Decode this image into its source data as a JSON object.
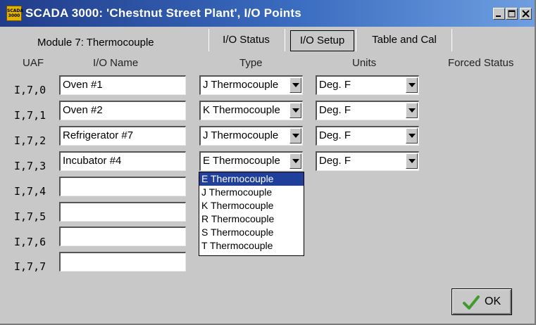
{
  "window": {
    "title": "SCADA 3000: 'Chestnut Street Plant', I/O Points",
    "app_icon_text": "SCADA 3000"
  },
  "module_label": "Module 7: Thermocouple",
  "tabs": [
    {
      "label": "I/O Status",
      "active": false
    },
    {
      "label": "I/O Setup",
      "active": true
    },
    {
      "label": "Table and Cal",
      "active": false
    }
  ],
  "headers": {
    "uaf": "UAF",
    "io_name": "I/O Name",
    "type": "Type",
    "units": "Units",
    "forced_status": "Forced Status"
  },
  "rows": [
    {
      "uaf": "I,7,0",
      "name": "Oven #1",
      "type": "J Thermocouple",
      "units": "Deg. F"
    },
    {
      "uaf": "I,7,1",
      "name": "Oven #2",
      "type": "K Thermocouple",
      "units": "Deg. F"
    },
    {
      "uaf": "I,7,2",
      "name": "Refrigerator #7",
      "type": "J Thermocouple",
      "units": "Deg. F"
    },
    {
      "uaf": "I,7,3",
      "name": "Incubator #4",
      "type": "E Thermocouple",
      "units": "Deg. F"
    },
    {
      "uaf": "I,7,4",
      "name": ""
    },
    {
      "uaf": "I,7,5",
      "name": ""
    },
    {
      "uaf": "I,7,6",
      "name": ""
    },
    {
      "uaf": "I,7,7",
      "name": ""
    }
  ],
  "type_dropdown": {
    "options": [
      "E Thermocouple",
      "J Thermocouple",
      "K Thermocouple",
      "R Thermocouple",
      "S Thermocouple",
      "T Thermocouple"
    ],
    "selected": "E Thermocouple"
  },
  "ok_button": {
    "label": "OK"
  },
  "colors": {
    "titlebar_start": "#213c8a",
    "titlebar_end": "#6f9fe0",
    "window_bg": "#c8c8c8",
    "selection": "#1f3f9a",
    "check_green": "#3f9b2a"
  },
  "icons": {
    "app": "scada-app-icon",
    "minimize": "minimize-icon",
    "maximize": "maximize-icon",
    "close": "close-icon",
    "ok": "checkmark-icon",
    "combo_arrow": "chevron-down-icon"
  }
}
